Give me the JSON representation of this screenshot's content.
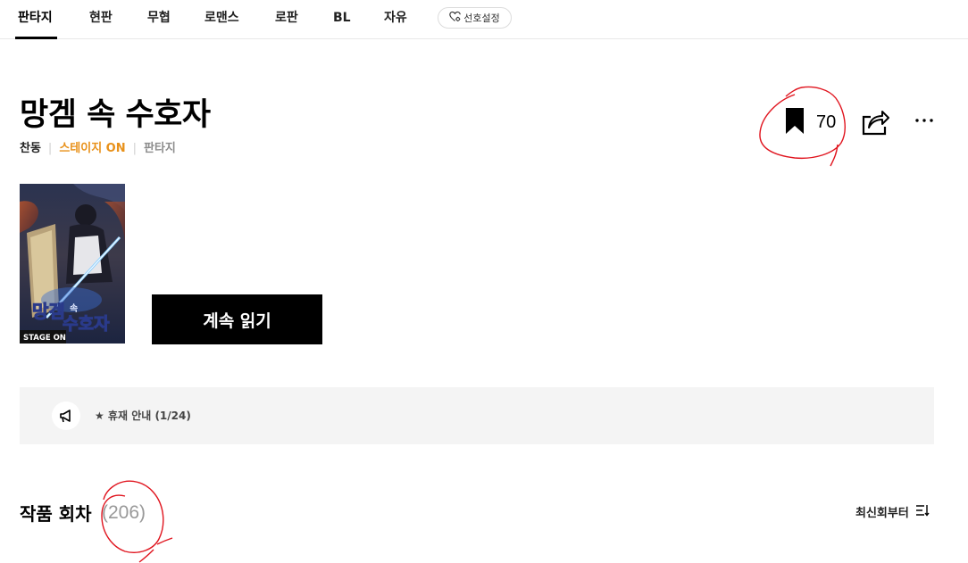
{
  "nav": {
    "tabs": [
      {
        "label": "판타지",
        "active": true
      },
      {
        "label": "현판"
      },
      {
        "label": "무협"
      },
      {
        "label": "로맨스"
      },
      {
        "label": "로판"
      },
      {
        "label": "BL"
      },
      {
        "label": "자유"
      }
    ],
    "preference_label": "선호설정"
  },
  "work": {
    "title": "망겜 속 수호자",
    "author": "찬동",
    "badge": "스테이지 ON",
    "genre": "판타지",
    "bookmark_count": "70",
    "cover": {
      "title_line1": "망겜",
      "title_small": "속",
      "title_line2": "수호자",
      "label": "STAGE ON"
    },
    "continue_label": "계속 읽기"
  },
  "notice": {
    "text": "★ 휴재 안내 (1/24)"
  },
  "episodes": {
    "heading": "작품 회차",
    "count": "(206)",
    "sort_label": "최신회부터"
  },
  "colors": {
    "accent": "#e8911a",
    "annotation": "#e0141e",
    "notice_bg": "#f4f4f4"
  },
  "icons": [
    "heart-settings-icon",
    "bookmark-icon",
    "share-icon",
    "more-icon",
    "megaphone-icon",
    "sort-icon"
  ]
}
